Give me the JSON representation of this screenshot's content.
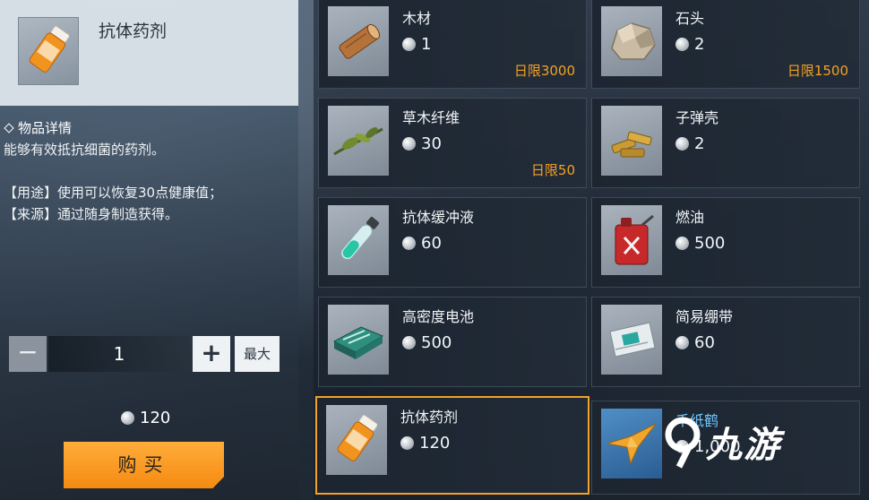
{
  "detail": {
    "title": "抗体药剂",
    "icon": "pill-bottle-icon",
    "info_heading": "物品详情",
    "description": "能够有效抵抗细菌的药剂。",
    "usage": "【用途】使用可以恢复30点健康值；",
    "source": "【来源】通过随身制造获得。"
  },
  "quantity": {
    "minus_label": "−",
    "value": "1",
    "plus_label": "+",
    "max_label": "最大"
  },
  "total_price": "120",
  "buy_label": "购买",
  "items": [
    {
      "name": "木材",
      "price": "1",
      "limit": "日限3000",
      "icon": "wood-log-icon"
    },
    {
      "name": "石头",
      "price": "2",
      "limit": "日限1500",
      "icon": "stone-icon"
    },
    {
      "name": "草木纤维",
      "price": "30",
      "limit": "日限50",
      "icon": "plant-fiber-icon"
    },
    {
      "name": "子弹壳",
      "price": "2",
      "limit": "",
      "icon": "bullet-shell-icon"
    },
    {
      "name": "抗体缓冲液",
      "price": "60",
      "limit": "",
      "icon": "test-tube-icon"
    },
    {
      "name": "燃油",
      "price": "500",
      "limit": "",
      "icon": "fuel-can-icon"
    },
    {
      "name": "高密度电池",
      "price": "500",
      "limit": "",
      "icon": "battery-pack-icon"
    },
    {
      "name": "简易绷带",
      "price": "60",
      "limit": "",
      "icon": "bandage-icon"
    },
    {
      "name": "抗体药剂",
      "price": "120",
      "limit": "",
      "icon": "pill-bottle-icon",
      "selected": true
    },
    {
      "name": "千纸鹤",
      "price": "1,000",
      "limit": "",
      "icon": "paper-crane-icon"
    }
  ],
  "watermark": "九游",
  "colors": {
    "accent": "#f58a12",
    "limit_text": "#f5a023",
    "selected_border": "#f2a12a"
  }
}
